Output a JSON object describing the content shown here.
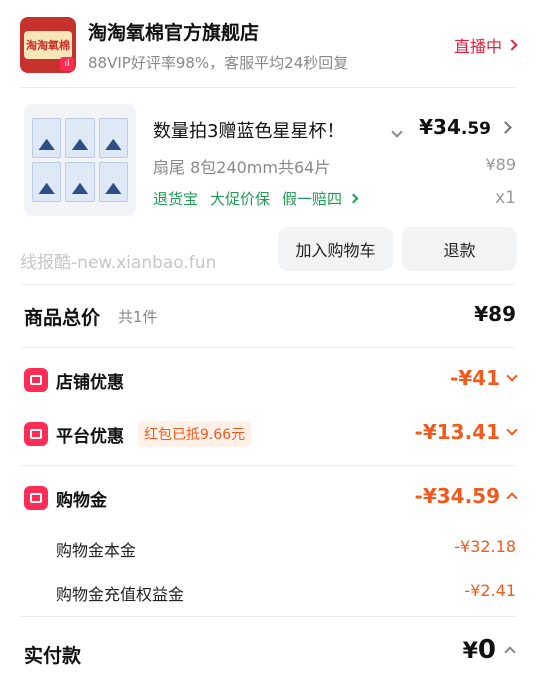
{
  "store": {
    "logo_text": "淘淘氧棉",
    "name": "淘淘氧棉官方旗舰店",
    "subtitle": "88VIP好评率98%，客服平均24秒回复",
    "live_label": "直播中"
  },
  "product": {
    "title": "数量拍3赠蓝色星星杯！",
    "price_main": "¥34",
    "price_cents": ".59",
    "spec": "扇尾 8包240mm共64片",
    "original_price": "¥89",
    "tags": [
      "退货宝",
      "大促价保",
      "假一赔四"
    ],
    "quantity": "x1"
  },
  "watermark": "线报酷-new.xianbao.fun",
  "actions": {
    "add_cart_label": "加入购物车",
    "refund_label": "退款"
  },
  "summary": {
    "total_label": "商品总价",
    "total_count": "共1件",
    "total_value": "¥89",
    "shop_discount_label": "店铺优惠",
    "shop_discount_value": "-¥41",
    "platform_discount_label": "平台优惠",
    "platform_discount_tag": "红包已抵9.66元",
    "platform_discount_value": "-¥13.41",
    "shopping_gold_label": "购物金",
    "shopping_gold_value": "-¥34.59",
    "gold_principal_label": "购物金本金",
    "gold_principal_value": "-¥32.18",
    "gold_bonus_label": "购物金充值权益金",
    "gold_bonus_value": "-¥2.41",
    "paid_label": "实付款",
    "paid_currency": "¥",
    "paid_value": "0"
  },
  "colors": {
    "accent_red": "#e0233d",
    "discount_orange": "#f25a1d",
    "guarantee_green": "#1f9d55"
  }
}
